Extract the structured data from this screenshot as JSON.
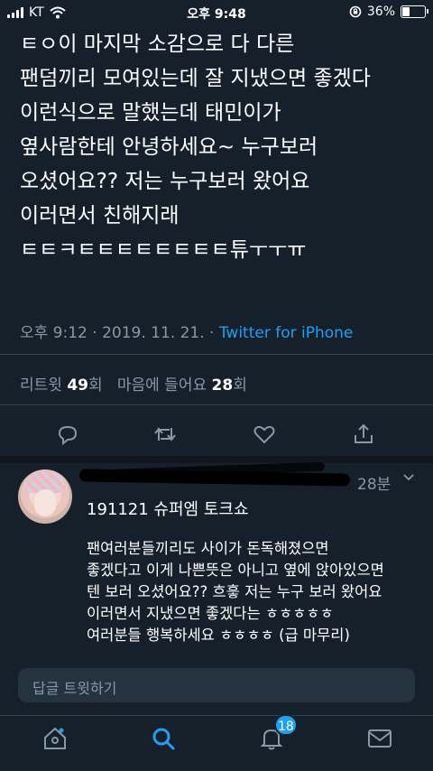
{
  "status_bar": {
    "carrier": "KT",
    "time": "오후 9:48",
    "battery": "36%",
    "battery_level": 0.36
  },
  "tweet": {
    "lines": [
      "ㅌㅇ이 마지막 소감으로 다 다른",
      "팬덤끼리 모여있는데 잘 지냈으면 좋겠다",
      "이런식으로 말했는데 태민이가",
      "옆사람한테 안녕하세요~ 누구보러",
      "오셨어요?? 저는 누구보러 왔어요",
      "이러면서 친해지래",
      "ㅌㅌㅋㅌㅌㅌㅌㅌㅌㅌㅌ튜ㅜㅜㅠ"
    ],
    "timestamp": "오후 9:12 · 2019. 11. 21. ·",
    "source": "Twitter for iPhone",
    "retweets_label": "리트윗",
    "retweets_count": "49",
    "retweets_unit": "회",
    "likes_label": "마음에 들어요",
    "likes_count": "28",
    "likes_unit": "회"
  },
  "reply": {
    "time": "28분",
    "title": "191121 슈퍼엠 토크쇼",
    "body_lines": [
      "팬여러분들끼리도 사이가 돈독해졌으면",
      "좋겠다고 이게 나쁜뜻은 아니고 옆에 앉아있으면",
      "텐 보러 오셨어요?? 흐흫 저는 누구 보러 왔어요",
      "이러면서 지냈으면 좋겠다는 ㅎㅎㅎㅎㅎ",
      "여러분들 행복하세요 ㅎㅎㅎㅎ (급 마무리)"
    ]
  },
  "compose": {
    "placeholder": "답글 트윗하기"
  },
  "tabbar": {
    "notifications_badge": "18"
  },
  "colors": {
    "background": "#15202b",
    "accent": "#1da1f2",
    "muted": "#8899a6",
    "divider": "#38444d"
  }
}
